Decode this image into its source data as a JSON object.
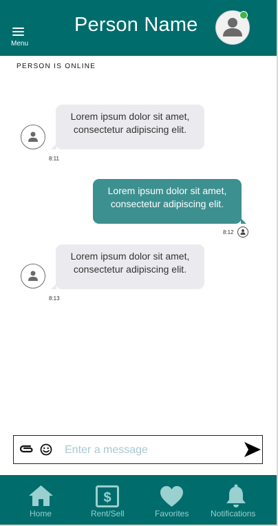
{
  "header": {
    "menu_label": "Menu",
    "title": "Person Name",
    "online_dot_color": "#3fb64a"
  },
  "status": "PERSON IS ONLINE",
  "messages": [
    {
      "direction": "received",
      "lines": [
        "Lorem ipsum dolor sit amet,",
        "consectetur adipiscing elit."
      ],
      "time": "8:11"
    },
    {
      "direction": "sent",
      "lines": [
        "Lorem ipsum dolor sit amet,",
        "consectetur adipiscing elit."
      ],
      "time": "8:12"
    },
    {
      "direction": "received",
      "lines": [
        "Lorem ipsum dolor sit amet,",
        "consectetur adipiscing elit."
      ],
      "time": "8:13"
    }
  ],
  "composer": {
    "placeholder": "Enter a message",
    "attach_icon": "paperclip-icon",
    "emoji_icon": "smiley-icon",
    "send_icon": "send-arrow-icon"
  },
  "nav": {
    "items": [
      {
        "label": "Home",
        "icon": "home-icon"
      },
      {
        "label": "Rent/Sell",
        "icon": "dollar-icon"
      },
      {
        "label": "Favorites",
        "icon": "heart-icon"
      },
      {
        "label": "Notifications",
        "icon": "bell-icon"
      }
    ]
  },
  "colors": {
    "primary": "#006c6c",
    "sent_bubble": "#3d9090",
    "received_bubble": "#ebebef",
    "nav_label": "#9ad0d0"
  }
}
